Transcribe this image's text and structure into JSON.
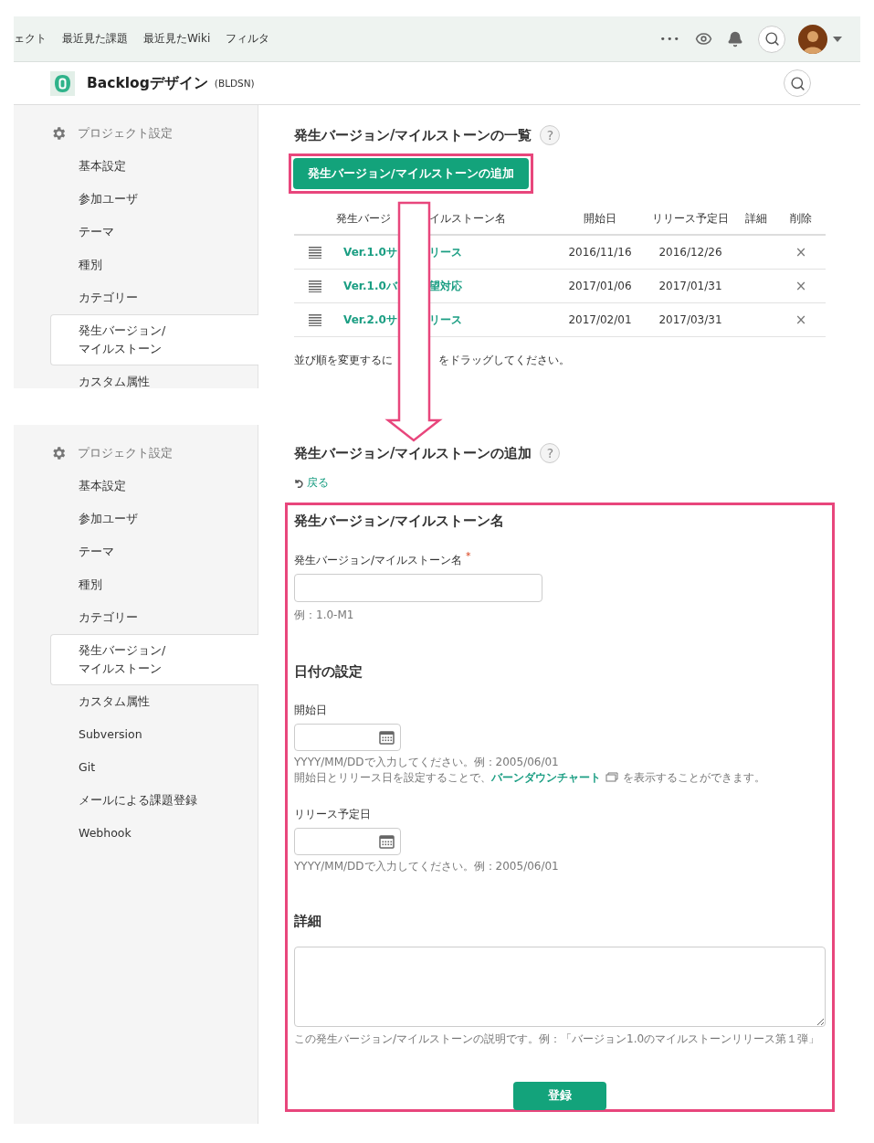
{
  "top_screen": {
    "global_nav": {
      "items": [
        {
          "label": "ェクト"
        },
        {
          "label": "最近見た課題"
        },
        {
          "label": "最近見たWiki"
        },
        {
          "label": "フィルタ"
        }
      ],
      "more": "•••"
    },
    "project": {
      "name": "Backlogデザイン",
      "key": "(BLDSN)"
    },
    "sidebar": {
      "title": "プロジェクト設定",
      "items": [
        {
          "lines": [
            "基本設定"
          ],
          "selected": false
        },
        {
          "lines": [
            "参加ユーザ"
          ],
          "selected": false
        },
        {
          "lines": [
            "テーマ"
          ],
          "selected": false
        },
        {
          "lines": [
            "種別"
          ],
          "selected": false
        },
        {
          "lines": [
            "カテゴリー"
          ],
          "selected": false
        },
        {
          "lines": [
            "発生バージョン/",
            "マイルストーン"
          ],
          "selected": true
        },
        {
          "lines": [
            "カスタム属性"
          ],
          "selected": false
        }
      ]
    },
    "list": {
      "title": "発生バージョン/マイルストーンの一覧",
      "help": "?",
      "add_button": {
        "label": "発生バージョン/マイルストーンの追加",
        "highlighted": true
      },
      "name_header_parts": [
        "発生バージ",
        "イルストーン名"
      ],
      "columns": [
        "開始日",
        "リリース予定日",
        "詳細",
        "削除"
      ],
      "rows": [
        {
          "name_parts": [
            "Ver.1.0サ",
            "リース"
          ],
          "start": "2016/11/16",
          "release": "2016/12/26",
          "delete": "×"
        },
        {
          "name_parts": [
            "Ver.1.0バ",
            "望対応"
          ],
          "start": "2017/01/06",
          "release": "2017/01/31",
          "delete": "×"
        },
        {
          "name_parts": [
            "Ver.2.0サ",
            "リース"
          ],
          "start": "2017/02/01",
          "release": "2017/03/31",
          "delete": "×"
        }
      ],
      "note_parts": [
        "並び順を変更するに",
        "をドラッグしてください。"
      ]
    }
  },
  "bottom_screen": {
    "sidebar": {
      "title": "プロジェクト設定",
      "items": [
        {
          "lines": [
            "基本設定"
          ],
          "selected": false
        },
        {
          "lines": [
            "参加ユーザ"
          ],
          "selected": false
        },
        {
          "lines": [
            "テーマ"
          ],
          "selected": false
        },
        {
          "lines": [
            "種別"
          ],
          "selected": false
        },
        {
          "lines": [
            "カテゴリー"
          ],
          "selected": false
        },
        {
          "lines": [
            "発生バージョン/",
            "マイルストーン"
          ],
          "selected": true
        },
        {
          "lines": [
            "カスタム属性"
          ],
          "selected": false
        },
        {
          "lines": [
            "Subversion"
          ],
          "selected": false
        },
        {
          "lines": [
            "Git"
          ],
          "selected": false
        },
        {
          "lines": [
            "メールによる課題登録"
          ],
          "selected": false
        },
        {
          "lines": [
            "Webhook"
          ],
          "selected": false
        }
      ]
    },
    "form": {
      "title": "発生バージョン/マイルストーンの追加",
      "help": "?",
      "back": "戻る",
      "highlighted": true,
      "name_section": {
        "heading": "発生バージョン/マイルストーン名",
        "label": "発生バージョン/マイルストーン名",
        "required": "*",
        "hint": "例：1.0-M1"
      },
      "date_section": {
        "heading": "日付の設定",
        "start": {
          "label": "開始日",
          "hint": "YYYY/MM/DDで入力してください。例：2005/06/01",
          "note": {
            "before": "開始日とリリース日を設定することで、",
            "link": "バーンダウンチャート",
            "after": "を表示することができます。"
          }
        },
        "release": {
          "label": "リリース予定日",
          "hint": "YYYY/MM/DDで入力してください。例：2005/06/01"
        }
      },
      "detail_section": {
        "heading": "詳細",
        "hint": "この発生バージョン/マイルストーンの説明です。例：「バージョン1.0のマイルストーンリリース第１弾」"
      },
      "submit": "登録"
    }
  }
}
